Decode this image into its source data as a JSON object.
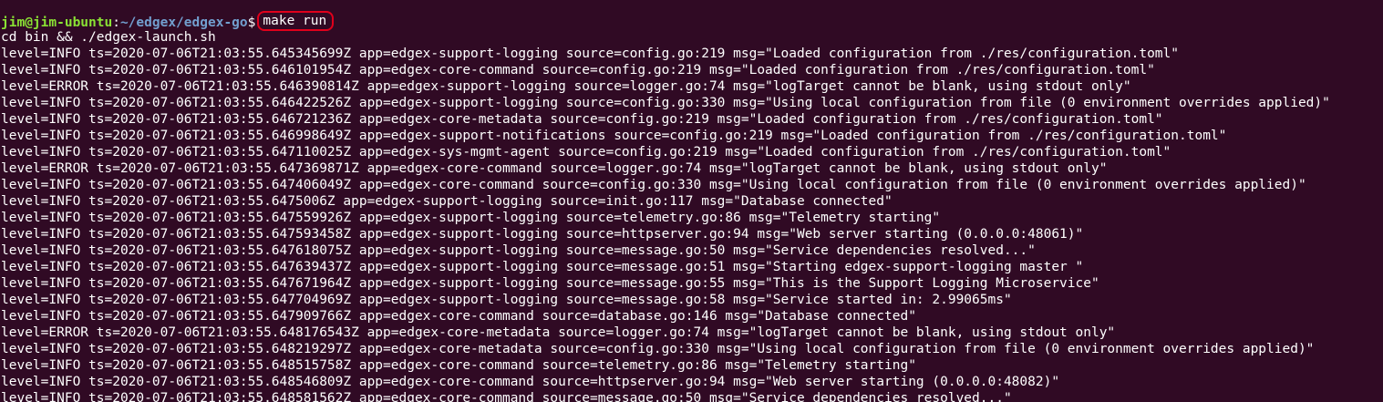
{
  "prompt": {
    "user_host": "jim@jim-ubuntu",
    "separator": ":",
    "path": "~/edgex/edgex-go",
    "symbol": "$",
    "command": "make run"
  },
  "lines": [
    "cd bin && ./edgex-launch.sh",
    "level=INFO ts=2020-07-06T21:03:55.645345699Z app=edgex-support-logging source=config.go:219 msg=\"Loaded configuration from ./res/configuration.toml\"",
    "level=INFO ts=2020-07-06T21:03:55.646101954Z app=edgex-core-command source=config.go:219 msg=\"Loaded configuration from ./res/configuration.toml\"",
    "level=ERROR ts=2020-07-06T21:03:55.646390814Z app=edgex-support-logging source=logger.go:74 msg=\"logTarget cannot be blank, using stdout only\"",
    "level=INFO ts=2020-07-06T21:03:55.646422526Z app=edgex-support-logging source=config.go:330 msg=\"Using local configuration from file (0 environment overrides applied)\"",
    "level=INFO ts=2020-07-06T21:03:55.646721236Z app=edgex-core-metadata source=config.go:219 msg=\"Loaded configuration from ./res/configuration.toml\"",
    "level=INFO ts=2020-07-06T21:03:55.646998649Z app=edgex-support-notifications source=config.go:219 msg=\"Loaded configuration from ./res/configuration.toml\"",
    "level=INFO ts=2020-07-06T21:03:55.647110025Z app=edgex-sys-mgmt-agent source=config.go:219 msg=\"Loaded configuration from ./res/configuration.toml\"",
    "level=ERROR ts=2020-07-06T21:03:55.647369871Z app=edgex-core-command source=logger.go:74 msg=\"logTarget cannot be blank, using stdout only\"",
    "level=INFO ts=2020-07-06T21:03:55.647406049Z app=edgex-core-command source=config.go:330 msg=\"Using local configuration from file (0 environment overrides applied)\"",
    "level=INFO ts=2020-07-06T21:03:55.6475006Z app=edgex-support-logging source=init.go:117 msg=\"Database connected\"",
    "level=INFO ts=2020-07-06T21:03:55.647559926Z app=edgex-support-logging source=telemetry.go:86 msg=\"Telemetry starting\"",
    "level=INFO ts=2020-07-06T21:03:55.647593458Z app=edgex-support-logging source=httpserver.go:94 msg=\"Web server starting (0.0.0.0:48061)\"",
    "level=INFO ts=2020-07-06T21:03:55.647618075Z app=edgex-support-logging source=message.go:50 msg=\"Service dependencies resolved...\"",
    "level=INFO ts=2020-07-06T21:03:55.647639437Z app=edgex-support-logging source=message.go:51 msg=\"Starting edgex-support-logging master \"",
    "level=INFO ts=2020-07-06T21:03:55.647671964Z app=edgex-support-logging source=message.go:55 msg=\"This is the Support Logging Microservice\"",
    "level=INFO ts=2020-07-06T21:03:55.647704969Z app=edgex-support-logging source=message.go:58 msg=\"Service started in: 2.99065ms\"",
    "level=INFO ts=2020-07-06T21:03:55.647909766Z app=edgex-core-command source=database.go:146 msg=\"Database connected\"",
    "level=ERROR ts=2020-07-06T21:03:55.648176543Z app=edgex-core-metadata source=logger.go:74 msg=\"logTarget cannot be blank, using stdout only\"",
    "level=INFO ts=2020-07-06T21:03:55.648219297Z app=edgex-core-metadata source=config.go:330 msg=\"Using local configuration from file (0 environment overrides applied)\"",
    "level=INFO ts=2020-07-06T21:03:55.648515758Z app=edgex-core-command source=telemetry.go:86 msg=\"Telemetry starting\"",
    "level=INFO ts=2020-07-06T21:03:55.648546809Z app=edgex-core-command source=httpserver.go:94 msg=\"Web server starting (0.0.0.0:48082)\"",
    "level=INFO ts=2020-07-06T21:03:55.648581562Z app=edgex-core-command source=message.go:50 msg=\"Service dependencies resolved...\""
  ],
  "colors": {
    "background": "#300a24",
    "text": "#ffffff",
    "prompt_user": "#8ae234",
    "prompt_path": "#729fcf",
    "highlight_border": "#e0001b"
  }
}
